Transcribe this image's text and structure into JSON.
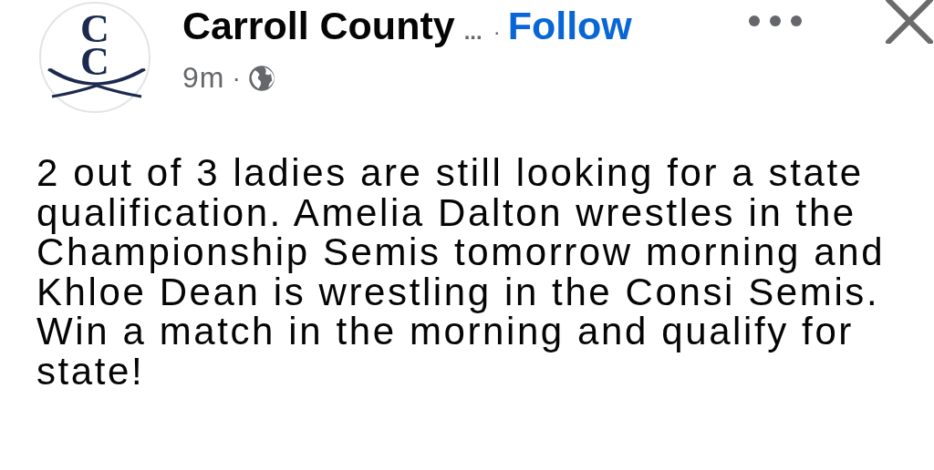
{
  "post": {
    "avatar": {
      "monogram": "CC"
    },
    "author": "Carroll County",
    "author_truncation": "...",
    "separator": "·",
    "follow_link": "Follow",
    "time": "9m",
    "time_separator": "·",
    "text_lines": [
      "2 out of 3 ladies are still looking for a state",
      "qualification. Amelia Dalton wrestles in the",
      "Championship Semis tomorrow morning and",
      "Khloe Dean is wrestling in the Consi Semis.",
      "Win a match in the morning and qualify for",
      "state!"
    ]
  }
}
